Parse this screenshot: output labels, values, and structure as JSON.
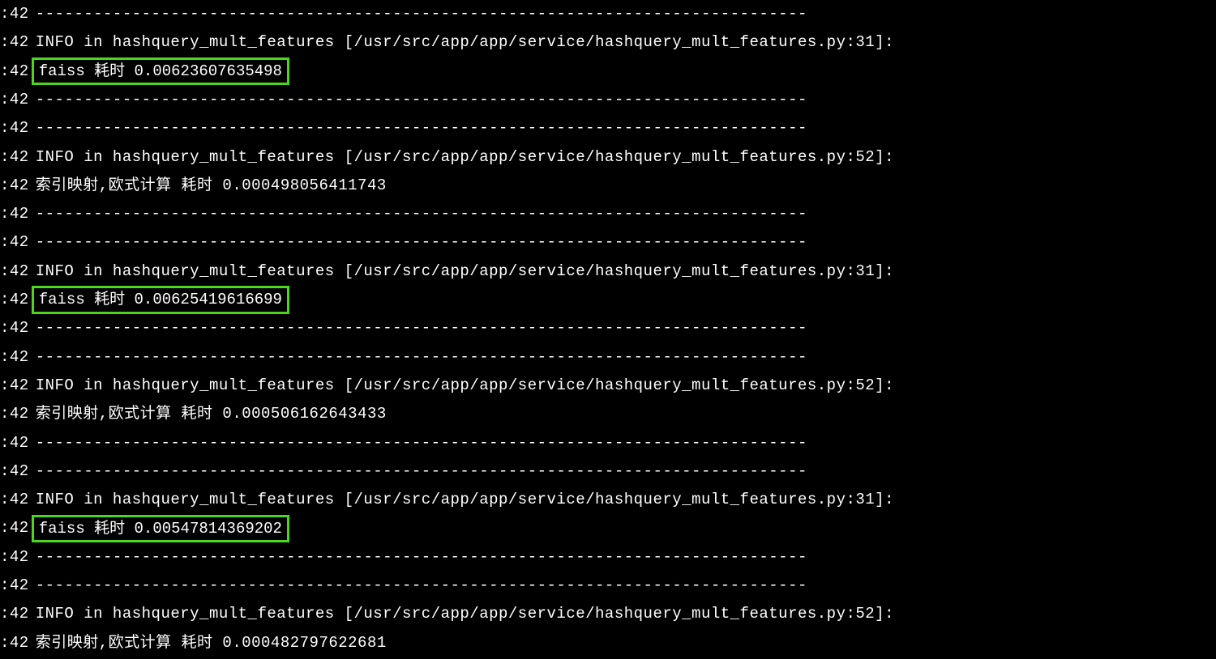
{
  "timestamp_prefix": ":42",
  "divider_line": "--------------------------------------------------------------------------------",
  "info_line_31": "INFO in hashquery_mult_features [/usr/src/app/app/service/hashquery_mult_features.py:31]:",
  "info_line_52": "INFO in hashquery_mult_features [/usr/src/app/app/service/hashquery_mult_features.py:52]:",
  "faiss_label": "faiss 耗时",
  "index_label": "索引映射,欧式计算 耗时",
  "log_entries": {
    "faiss_time_1": "0.00623607635498",
    "index_time_1": "0.000498056411743",
    "faiss_time_2": "0.00625419616699",
    "index_time_2": "0.000506162643433",
    "faiss_time_3": "0.00547814369202",
    "index_time_3": "0.000482797622681"
  },
  "highlight_1": "faiss 耗时 0.00623607635498",
  "highlight_2": "faiss 耗时 0.00625419616699",
  "highlight_3": "faiss 耗时 0.00547814369202",
  "index_line_1": "索引映射,欧式计算 耗时 0.000498056411743",
  "index_line_2": "索引映射,欧式计算 耗时 0.000506162643433",
  "index_line_3": "索引映射,欧式计算 耗时 0.000482797622681"
}
